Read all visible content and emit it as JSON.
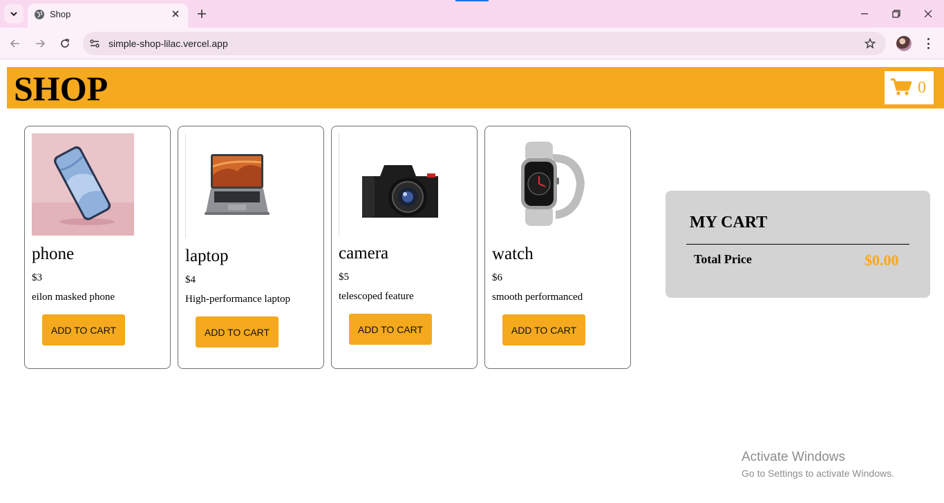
{
  "browser": {
    "tab_title": "Shop",
    "url": "simple-shop-lilac.vercel.app"
  },
  "header": {
    "logo": "SHOP",
    "cart_count": "0"
  },
  "products": [
    {
      "name": "phone",
      "price": "$3",
      "description": "eilon masked phone",
      "button": "ADD TO CART"
    },
    {
      "name": "laptop",
      "price": "$4",
      "description": "High-performance laptop",
      "button": "ADD TO CART"
    },
    {
      "name": "camera",
      "price": "$5",
      "description": "telescoped feature",
      "button": "ADD TO CART"
    },
    {
      "name": "watch",
      "price": "$6",
      "description": "smooth performanced",
      "button": "ADD TO CART"
    }
  ],
  "cart": {
    "title": "MY CART",
    "total_label": "Total Price",
    "total_value": "$0.00"
  },
  "watermark": {
    "line1": "Activate Windows",
    "line2": "Go to Settings to activate Windows."
  },
  "colors": {
    "accent": "#f5a91e",
    "cart_panel": "#d3d3d3",
    "tabstrip": "#f9d9ef"
  }
}
